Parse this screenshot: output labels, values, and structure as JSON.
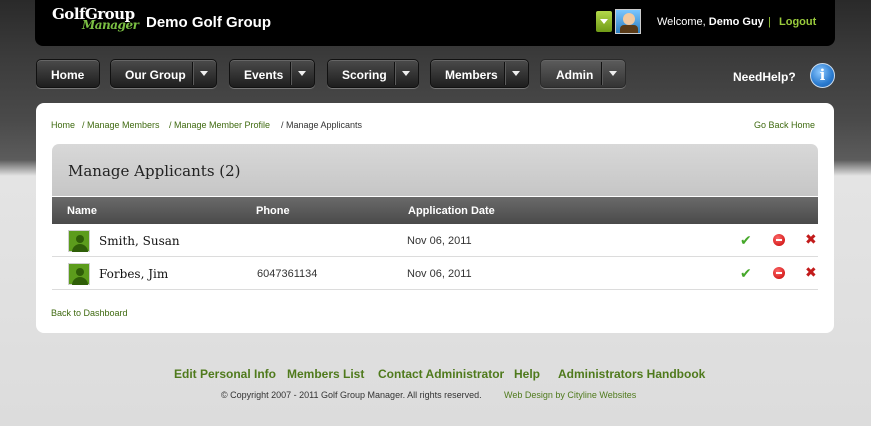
{
  "header": {
    "logo_line1": "GolfGroup",
    "logo_line2": "Manager",
    "group_name": "Demo Golf Group",
    "welcome_prefix": "Welcome, ",
    "user_name": "Demo Guy",
    "separator": "|",
    "logout_label": "Logout"
  },
  "nav": {
    "items": [
      {
        "label": "Home"
      },
      {
        "label": "Our Group"
      },
      {
        "label": "Events"
      },
      {
        "label": "Scoring"
      },
      {
        "label": "Members"
      },
      {
        "label": "Admin"
      }
    ],
    "help_label": "NeedHelp?",
    "info_glyph": "i"
  },
  "breadcrumb": {
    "items": [
      {
        "label": "Home"
      },
      {
        "label": "/ Manage Members"
      },
      {
        "label": "/ Manage Member Profile"
      },
      {
        "label": "/ Manage Applicants"
      }
    ],
    "go_back": "Go Back Home"
  },
  "main": {
    "title": "Manage Applicants (2)",
    "columns": [
      "Name",
      "Phone",
      "Application Date"
    ],
    "rows": [
      {
        "name": "Smith, Susan",
        "phone": "",
        "date": "Nov 06, 2011"
      },
      {
        "name": "Forbes, Jim",
        "phone": "6047361134",
        "date": "Nov 06, 2011"
      }
    ],
    "approve_glyph": "✔",
    "delete_glyph": "✖",
    "back_to_dashboard": "Back to Dashboard"
  },
  "footer": {
    "links": [
      {
        "label": "Edit Personal Info"
      },
      {
        "label": "Members List"
      },
      {
        "label": "Contact Administrator"
      },
      {
        "label": "Help"
      },
      {
        "label": "Administrators Handbook"
      }
    ],
    "copyright": "© Copyright 2007 - 2011 Golf Group Manager. All rights reserved.",
    "web_design": "Web Design by Cityline Websites"
  },
  "colors": {
    "accent_green": "#4f7a1c",
    "header_bg": "#000000",
    "approve": "#46a82a",
    "delete": "#c21b1b"
  }
}
